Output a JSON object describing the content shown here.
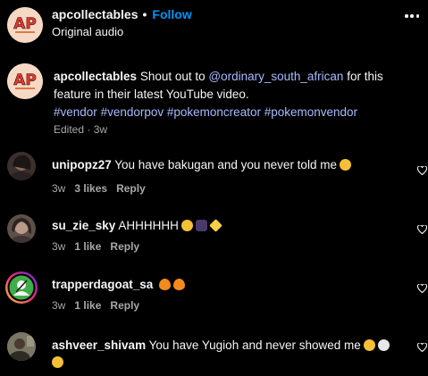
{
  "header": {
    "username": "apcollectables",
    "separator": "•",
    "follow_label": "Follow",
    "subtitle": "Original audio",
    "avatar_text": "AP"
  },
  "caption": {
    "username": "apcollectables",
    "text_before": "Shout out to",
    "mention": "@ordinary_south_african",
    "text_after": "for this feature in their latest YouTube video.",
    "hashtags": [
      "#vendor",
      "#vendorpov",
      "#pokemoncreator",
      "#pokemonvendor"
    ],
    "meta": "Edited · 3w"
  },
  "comments": [
    {
      "username": "unipopz27",
      "text": "You have bakugan and you never told me",
      "emojis": [
        "face-with-tears-of-joy"
      ],
      "time": "3w",
      "likes": "3 likes",
      "reply": "Reply"
    },
    {
      "username": "su_zie_sky",
      "text": "AHHHHHH",
      "emojis": [
        "heart-eyes",
        "purple-heart",
        "sparkles"
      ],
      "time": "3w",
      "likes": "1 like",
      "reply": "Reply"
    },
    {
      "username": "trapperdagoat_sa",
      "text": "",
      "emojis": [
        "fire",
        "fire"
      ],
      "time": "3w",
      "likes": "1 like",
      "reply": "Reply"
    },
    {
      "username": "ashveer_shivam",
      "text": "You have Yugioh and never showed me",
      "emojis": [
        "face-with-tears-of-joy",
        "skull",
        "face-with-tears-of-joy"
      ],
      "time": "",
      "likes": "",
      "reply": ""
    }
  ],
  "colors": {
    "accent": "#0095f6",
    "link": "#a6bbff",
    "muted": "#a8a8a8",
    "background": "#000000"
  }
}
